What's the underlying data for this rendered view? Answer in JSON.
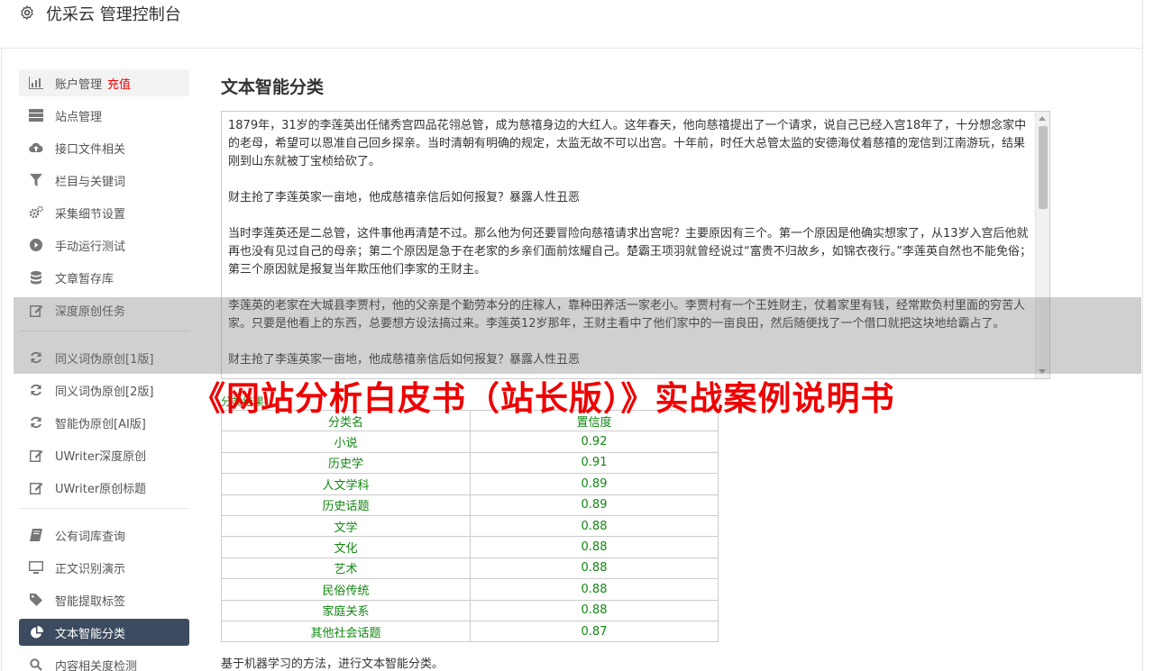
{
  "header": {
    "icon": "gear-icon",
    "title": "优采云 管理控制台"
  },
  "sidebar": {
    "items": [
      {
        "label": "账户管理",
        "badge": "充值",
        "icon": "bar-chart-icon"
      },
      {
        "label": "站点管理",
        "icon": "server-icon"
      },
      {
        "label": "接口文件相关",
        "icon": "cloud-upload-icon"
      },
      {
        "label": "栏目与关键词",
        "icon": "filter-icon"
      },
      {
        "label": "采集细节设置",
        "icon": "gears-icon"
      },
      {
        "label": "手动运行测试",
        "icon": "play-icon"
      },
      {
        "label": "文章暂存库",
        "icon": "database-icon"
      },
      {
        "label": "深度原创任务",
        "icon": "edit-icon"
      },
      {
        "label": "同义词伪原创[1版]",
        "icon": "refresh-icon"
      },
      {
        "label": "同义词伪原创[2版]",
        "icon": "refresh-icon"
      },
      {
        "label": "智能伪原创[AI版]",
        "icon": "refresh-icon"
      },
      {
        "label": "UWriter深度原创",
        "icon": "edit-icon"
      },
      {
        "label": "UWriter原创标题",
        "icon": "edit-icon"
      },
      {
        "label": "公有词库查询",
        "icon": "book-icon"
      },
      {
        "label": "正文识别演示",
        "icon": "monitor-icon"
      },
      {
        "label": "智能提取标签",
        "icon": "tag-icon"
      },
      {
        "label": "文本智能分类",
        "icon": "pie-chart-icon"
      },
      {
        "label": "内容相关度检测",
        "icon": "search-icon"
      }
    ]
  },
  "main": {
    "title": "文本智能分类",
    "text": "1879年，31岁的李莲英出任储秀宫四品花翎总管，成为慈禧身边的大红人。这年春天，他向慈禧提出了一个请求，说自己已经入宫18年了，十分想念家中的老母，希望可以恩准自己回乡探亲。当时清朝有明确的规定，太监无故不可以出宫。十年前，时任大总管太监的安德海仗着慈禧的宠信到江南游玩，结果刚到山东就被丁宝桢给砍了。\n\n财主抢了李莲英家一亩地，他成慈禧亲信后如何报复？暴露人性丑恶\n\n当时李莲英还是二总管，这件事他再清楚不过。那么他为何还要冒险向慈禧请求出宫呢？主要原因有三个。第一个原因是他确实想家了，从13岁入宫后他就再也没有见过自己的母亲；第二个原因是急于在老家的乡亲们面前炫耀自己。楚霸王项羽就曾经说过“富贵不归故乡，如锦衣夜行。”李莲英自然也不能免俗；第三个原因就是报复当年欺压他们李家的王财主。\n\n李莲英的老家在大城县李贾村，他的父亲是个勤劳本分的庄稼人，靠种田养活一家老小。李贾村有一个王姓财主，仗着家里有钱，经常欺负村里面的穷苦人家。只要是他看上的东西，总要想方设法搞过来。李莲英12岁那年，王财主看中了他们家中的一亩良田，然后随便找了一个借口就把这块地给霸占了。\n\n财主抢了李莲英家一亩地，他成慈禧亲信后如何报复？暴露人性丑恶",
    "result_label": "分类结果：",
    "table": {
      "headers": [
        "分类名",
        "置信度"
      ],
      "rows": [
        [
          "小说",
          "0.92"
        ],
        [
          "历史学",
          "0.91"
        ],
        [
          "人文学科",
          "0.89"
        ],
        [
          "历史话题",
          "0.89"
        ],
        [
          "文学",
          "0.88"
        ],
        [
          "文化",
          "0.88"
        ],
        [
          "艺术",
          "0.88"
        ],
        [
          "民俗传统",
          "0.88"
        ],
        [
          "家庭关系",
          "0.88"
        ],
        [
          "其他社会话题",
          "0.87"
        ]
      ]
    },
    "footnote": "基于机器学习的方法，进行文本智能分类。"
  },
  "watermark": "《网站分析白皮书（站长版）》实战案例说明书",
  "colors": {
    "active_nav": "#3c4b5f",
    "badge": "#e00000",
    "result_text": "#128712",
    "watermark": "#e00000"
  }
}
